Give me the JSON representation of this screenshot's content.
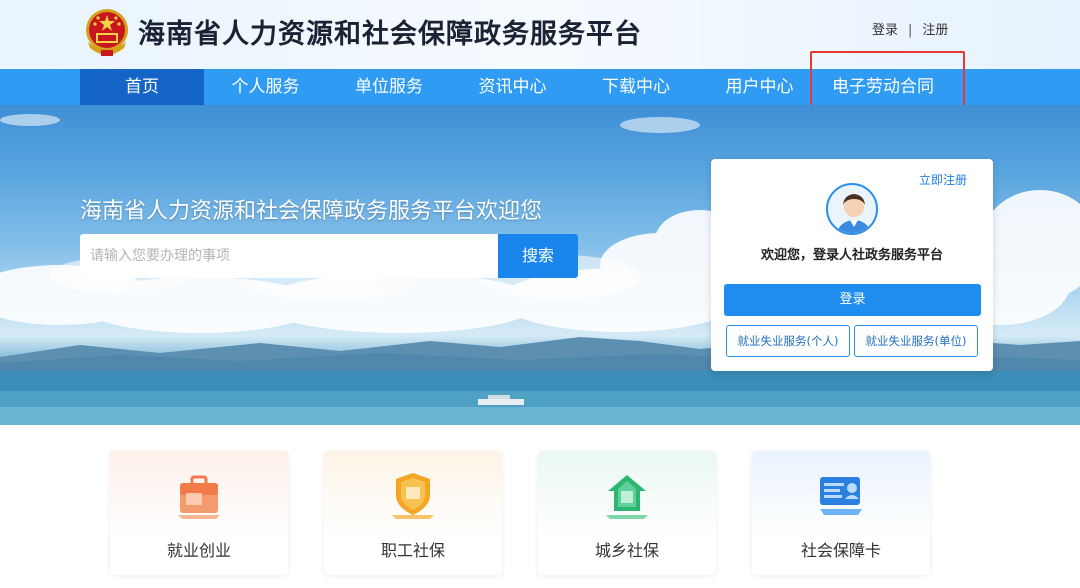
{
  "header": {
    "site_title": "海南省人力资源和社会保障政务服务平台",
    "login_link": "登录",
    "separator": "|",
    "register_link": "注册",
    "emblem_icon": "national-emblem-icon"
  },
  "nav": {
    "items": [
      {
        "label": "首页",
        "active": true
      },
      {
        "label": "个人服务",
        "active": false
      },
      {
        "label": "单位服务",
        "active": false
      },
      {
        "label": "资讯中心",
        "active": false
      },
      {
        "label": "下载中心",
        "active": false
      },
      {
        "label": "用户中心",
        "active": false
      },
      {
        "label": "电子劳动合同",
        "active": false
      }
    ],
    "highlighted_item": "电子劳动合同",
    "background_color": "#2f9bf3",
    "active_color": "#1565c8",
    "highlight_color": "#e53935"
  },
  "banner": {
    "welcome_text": "海南省人力资源和社会保障政务服务平台欢迎您",
    "search": {
      "placeholder": "请输入您要办理的事项",
      "value": "",
      "button_label": "搜索"
    }
  },
  "login_card": {
    "register_link": "立即注册",
    "avatar_icon": "user-avatar-icon",
    "welcome": "欢迎您，登录人社政务服务平台",
    "login_button": "登录",
    "personal_service_button": "就业失业服务(个人)",
    "unit_service_button": "就业失业服务(单位)"
  },
  "services": [
    {
      "label": "就业创业",
      "icon": "employment-briefcase-icon"
    },
    {
      "label": "职工社保",
      "icon": "worker-insurance-shield-icon"
    },
    {
      "label": "城乡社保",
      "icon": "rural-insurance-house-icon"
    },
    {
      "label": "社会保障卡",
      "icon": "social-security-card-icon"
    }
  ],
  "colors": {
    "primary": "#1f8cf0",
    "title_text": "#1b2233"
  }
}
